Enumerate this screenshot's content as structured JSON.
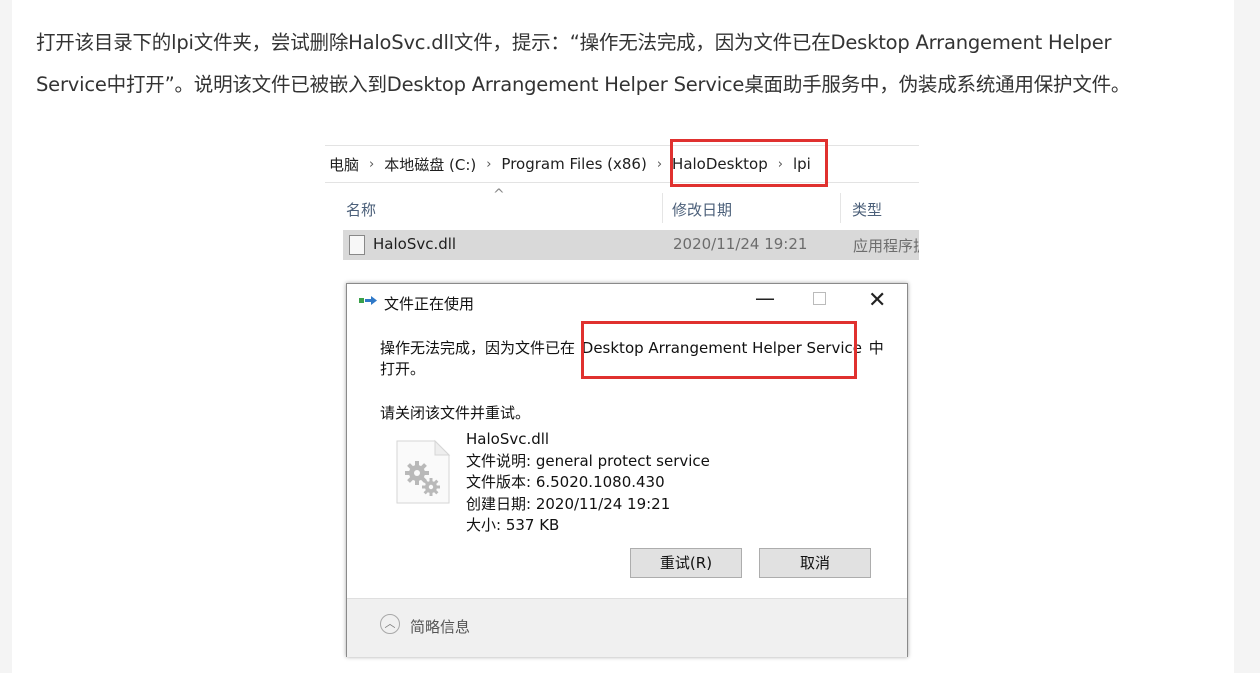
{
  "article": {
    "line1": "打开该目录下的lpi文件夹，尝试删除HaloSvc.dll文件，提示：“操作无法完成，因为文件已在Desktop Arrangement Helper",
    "line2": "Service中打开”。说明该文件已被嵌入到Desktop Arrangement Helper Service桌面助手服务中，伪装成系统通用保护文件。"
  },
  "explorer": {
    "breadcrumb": [
      "电脑",
      "本地磁盘 (C:)",
      "Program Files (x86)",
      "HaloDesktop",
      "lpi"
    ],
    "columns": {
      "name": "名称",
      "modified": "修改日期",
      "type": "类型"
    },
    "file": {
      "name": "HaloSvc.dll",
      "modified": "2020/11/24 19:21",
      "type": "应用程序扩"
    }
  },
  "dialog": {
    "title": "文件正在使用",
    "message_prefix": "操作无法完成，因为文件已在 ",
    "message_service": "Desktop Arrangement Helper Service",
    "message_suffix": " 中",
    "message_line2": "打开。",
    "please_close": "请关闭该文件并重试。",
    "file_name": "HaloSvc.dll",
    "file_description": "文件说明: general protect service",
    "file_version": "文件版本: 6.5020.1080.430",
    "created": "创建日期: 2020/11/24 19:21",
    "size": "大小: 537 KB",
    "retry_label": "重试(R)",
    "cancel_label": "取消",
    "brief_info": "简略信息",
    "minimize_glyph": "—",
    "close_glyph": "✕",
    "chevron_glyph": "︿",
    "sort_caret": "^",
    "sep_glyph": "›"
  },
  "colors": {
    "highlight_red": "#e0312f",
    "text": "#333333",
    "dialog_footer": "#f0f0f0"
  }
}
